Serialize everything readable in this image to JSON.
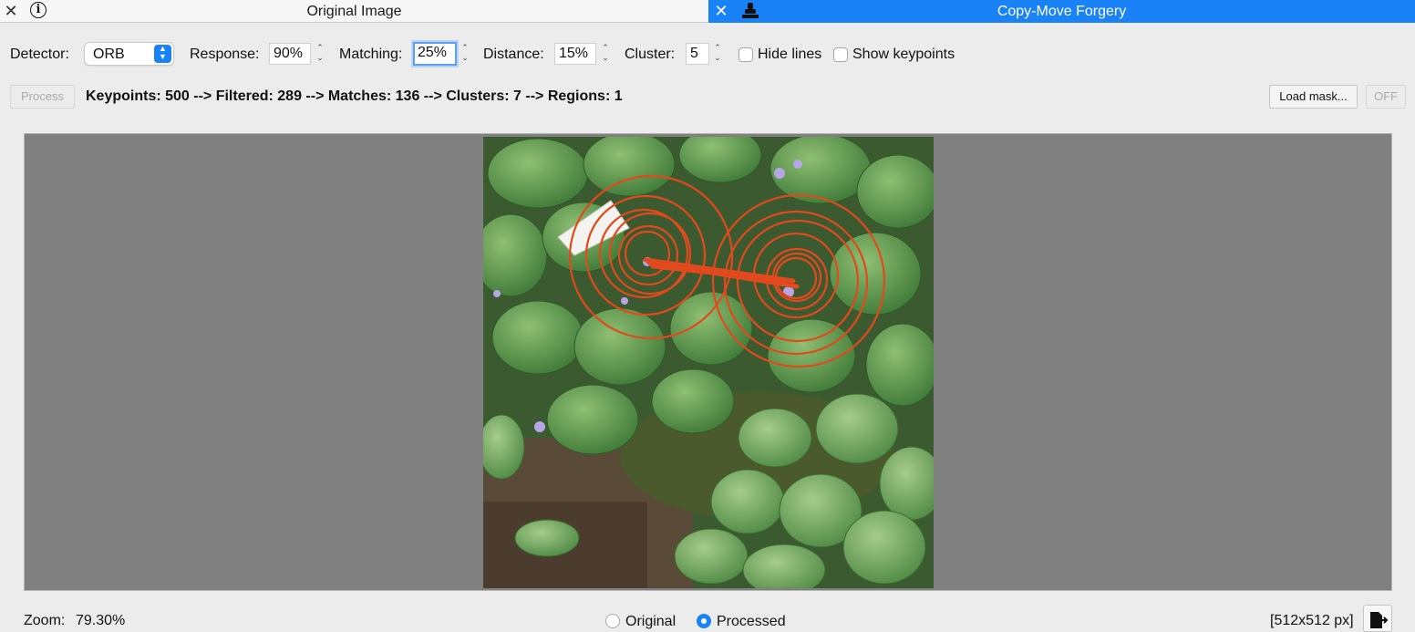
{
  "tabs": {
    "left_title": "Original Image",
    "right_title": "Copy-Move Forgery"
  },
  "toolbar": {
    "detector_label": "Detector:",
    "detector_value": "ORB",
    "response_label": "Response:",
    "response_value": "90%",
    "matching_label": "Matching:",
    "matching_value": "25%",
    "distance_label": "Distance:",
    "distance_value": "15%",
    "cluster_label": "Cluster:",
    "cluster_value": "5",
    "hide_lines_label": "Hide lines",
    "show_keypoints_label": "Show keypoints"
  },
  "actions": {
    "process_label": "Process",
    "status_text": "Keypoints: 500 --> Filtered: 289 --> Matches: 136 --> Clusters: 7 --> Regions: 1",
    "load_mask_label": "Load mask...",
    "off_label": "OFF"
  },
  "footer": {
    "zoom_label": "Zoom:",
    "zoom_value": "79.30%",
    "radio_original": "Original",
    "radio_processed": "Processed",
    "radio_selected": "Processed",
    "image_size": "[512x512 px]"
  },
  "colors": {
    "accent": "#1a82f7",
    "canvas_bg": "#808080",
    "match_lines": "#e2491c"
  },
  "icons": [
    "close-icon",
    "info-icon",
    "stamp-icon",
    "chevron-updown-icon",
    "export-icon"
  ]
}
